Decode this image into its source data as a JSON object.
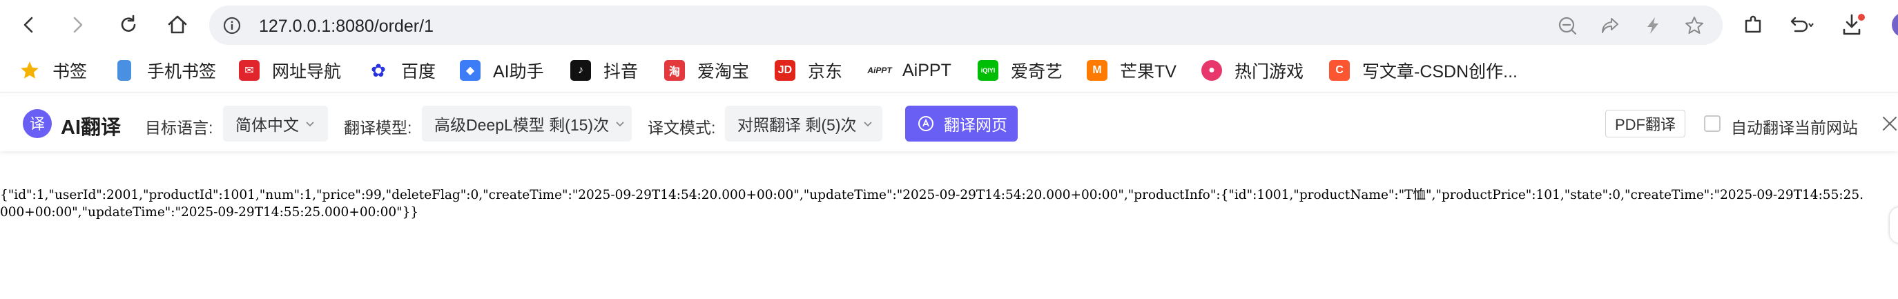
{
  "browser": {
    "address": "127.0.0.1:8080/order/1",
    "icons": [
      "back-icon",
      "forward-icon",
      "reload-icon",
      "home-icon",
      "info-icon",
      "zoom-out-icon",
      "share-icon",
      "bolt-icon",
      "star-icon",
      "extensions-icon",
      "undo-icon",
      "download-icon"
    ]
  },
  "bookmarks": [
    {
      "label": "书签",
      "color": "#f5b301"
    },
    {
      "label": "手机书签",
      "color": "#4a90e2"
    },
    {
      "label": "网址导航",
      "color": "#e0262c"
    },
    {
      "label": "百度",
      "color": "#2932e1"
    },
    {
      "label": "AI助手",
      "color": "#3c7cf6"
    },
    {
      "label": "抖音",
      "color": "#111111"
    },
    {
      "label": "爱淘宝",
      "color": "#e4393c"
    },
    {
      "label": "京东",
      "color": "#e1251b"
    },
    {
      "label": "AiPPT",
      "color": "#222222"
    },
    {
      "label": "爱奇艺",
      "color": "#00be06"
    },
    {
      "label": "芒果TV",
      "color": "#ff7a00"
    },
    {
      "label": "热门游戏",
      "color": "#e8386b"
    },
    {
      "label": "写文章-CSDN创作...",
      "color": "#fc5531"
    }
  ],
  "translator": {
    "brand": "AI翻译",
    "target_label": "目标语言:",
    "target_value": "简体中文",
    "model_label": "翻译模型:",
    "model_value": "高级DeepL模型 剩(15)次",
    "mode_label": "译文模式:",
    "mode_value": "对照翻译 剩(5)次",
    "translate_button": "翻译网页",
    "pdf_button": "PDF翻译",
    "auto_label": "自动翻译当前网站",
    "accent": "#6a5ff4"
  },
  "page": {
    "json_text": "{\"id\":1,\"userId\":2001,\"productId\":1001,\"num\":1,\"price\":99,\"deleteFlag\":0,\"createTime\":\"2025-09-29T14:54:20.000+00:00\",\"updateTime\":\"2025-09-29T14:54:20.000+00:00\",\"productInfo\":{\"id\":1001,\"productName\":\"T恤\",\"productPrice\":101,\"state\":0,\"createTime\":\"2025-09-29T14:55:25.000+00:00\",\"updateTime\":\"2025-09-29T14:55:25.000+00:00\"}}"
  }
}
